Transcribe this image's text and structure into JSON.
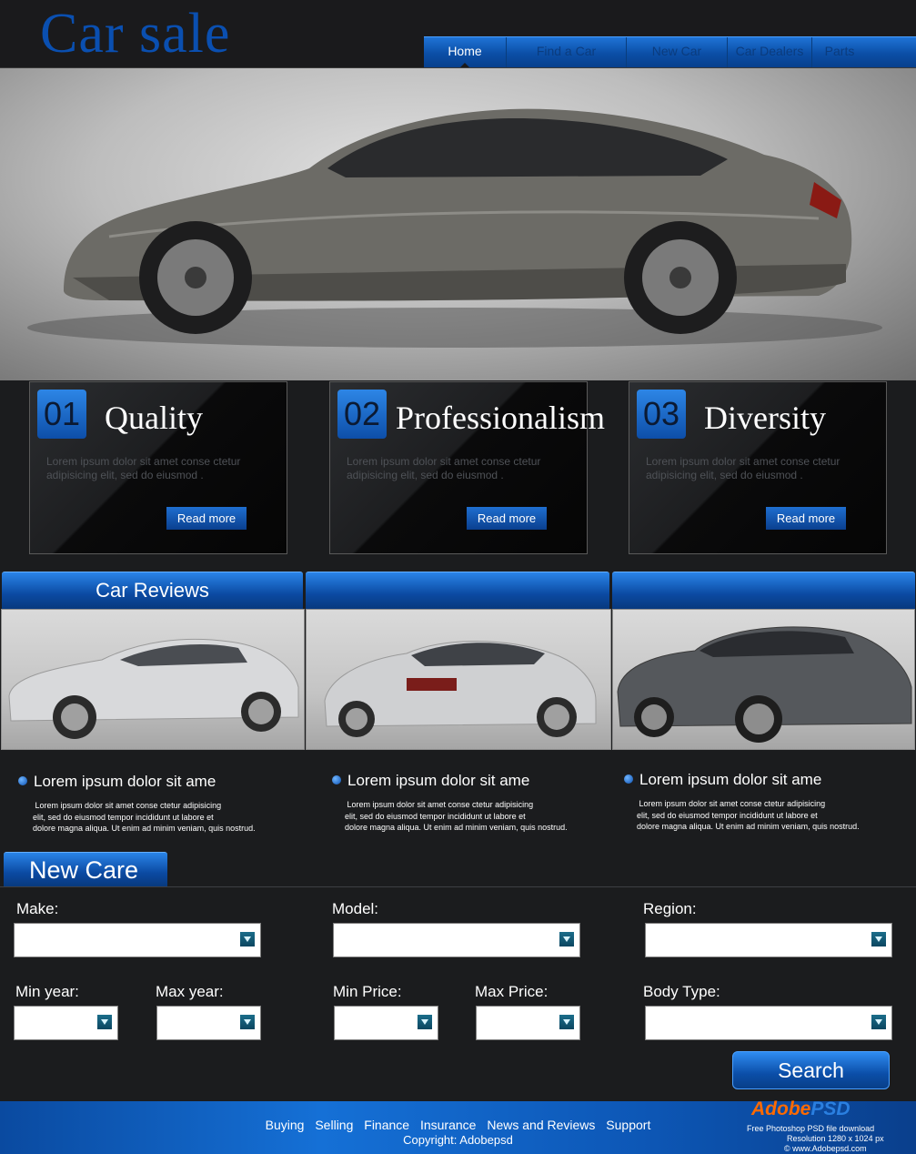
{
  "header": {
    "logo": "Car sale",
    "nav": [
      "Home",
      "Find a Car",
      "New Car",
      "Car Dealers",
      "Parts"
    ],
    "active_nav": "Home"
  },
  "features": [
    {
      "num": "01",
      "title": "Quality",
      "desc": "Lorem ipsum dolor sit amet conse ctetur adipisicing elit, sed do eiusmod .",
      "button": "Read more"
    },
    {
      "num": "02",
      "title": "Professionalism",
      "desc": "Lorem ipsum dolor sit amet conse ctetur adipisicing elit, sed do eiusmod .",
      "button": "Read more"
    },
    {
      "num": "03",
      "title": "Diversity",
      "desc": "Lorem ipsum dolor sit amet conse ctetur adipisicing elit, sed do eiusmod .",
      "button": "Read more"
    }
  ],
  "reviews": {
    "heading": "Car Reviews",
    "items": [
      {
        "title": "Lorem ipsum dolor sit ame",
        "line1": " Lorem ipsum dolor sit amet conse ctetur adipisicing",
        "line2": "elit, sed do eiusmod tempor incididunt ut labore et",
        "line3": "dolore magna aliqua. Ut enim ad minim veniam, quis nostrud."
      },
      {
        "title": "Lorem ipsum dolor sit ame",
        "line1": " Lorem ipsum dolor sit amet conse ctetur adipisicing",
        "line2": "elit, sed do eiusmod tempor incididunt ut labore et",
        "line3": "dolore magna aliqua. Ut enim ad minim veniam, quis nostrud."
      },
      {
        "title": "Lorem ipsum dolor sit ame",
        "line1": " Lorem ipsum dolor sit amet conse ctetur adipisicing",
        "line2": "elit, sed do eiusmod tempor incididunt ut labore et",
        "line3": "dolore magna aliqua. Ut enim ad minim veniam, quis nostrud."
      }
    ]
  },
  "search": {
    "heading": "New Care",
    "make": "Make:",
    "model": "Model:",
    "region": "Region:",
    "min_year": "Min year:",
    "max_year": "Max year:",
    "min_price": "Min Price:",
    "max_price": "Max Price:",
    "body_type": "Body Type:",
    "button": "Search"
  },
  "footer": {
    "links": [
      "Buying",
      "Selling",
      "Finance",
      "Insurance",
      "News and Reviews",
      "Support"
    ],
    "copyright": "Copyright: Adobepsd"
  },
  "watermark": {
    "brand_a": "Adobe",
    "brand_b": "PSD",
    "line1": "Free Photoshop PSD file download",
    "line2": "Resolution 1280 x 1024 px",
    "line3": "© www.Adobepsd.com"
  },
  "colors": {
    "accent": "#0b4ea6",
    "background": "#1b1c1e"
  }
}
